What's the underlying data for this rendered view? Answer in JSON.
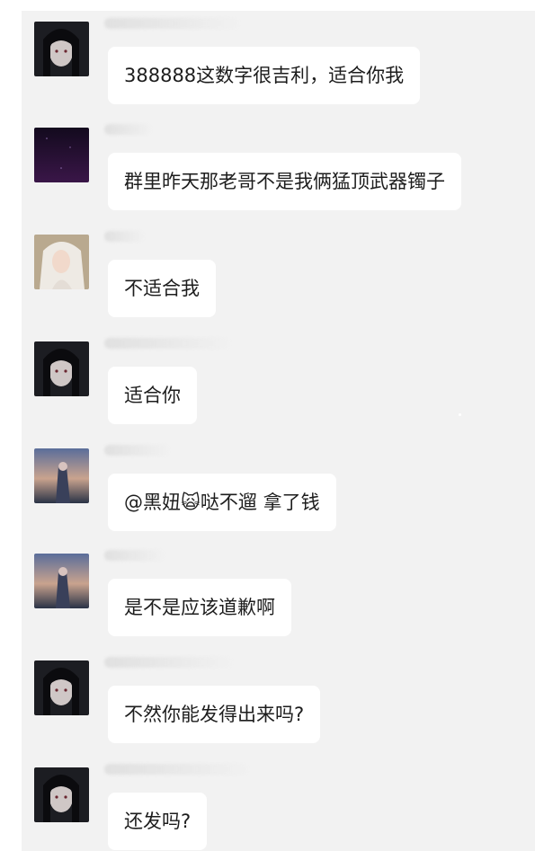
{
  "chat": {
    "messages": [
      {
        "avatar": "dark-hair-girl-avatar",
        "text": "388888这数字很吉利，适合你我"
      },
      {
        "avatar": "purple-night-avatar",
        "text": "群里昨天那老哥不是我俩猛顶武器镯子"
      },
      {
        "avatar": "white-hair-girl-avatar",
        "text": "不适合我"
      },
      {
        "avatar": "dark-hair-girl-avatar",
        "text": "适合你"
      },
      {
        "avatar": "sunset-girl-avatar",
        "text": "@黑妞🙀哒不遛 拿了钱"
      },
      {
        "avatar": "sunset-girl-avatar",
        "text": "是不是应该道歉啊"
      },
      {
        "avatar": "dark-hair-girl-avatar",
        "text": "不然你能发得出来吗?"
      },
      {
        "avatar": "dark-hair-girl-avatar",
        "text": "还发吗?"
      }
    ]
  },
  "colors": {
    "chat_background": "#f2f2f2",
    "bubble_background": "#ffffff",
    "text": "#1d1d1d"
  }
}
